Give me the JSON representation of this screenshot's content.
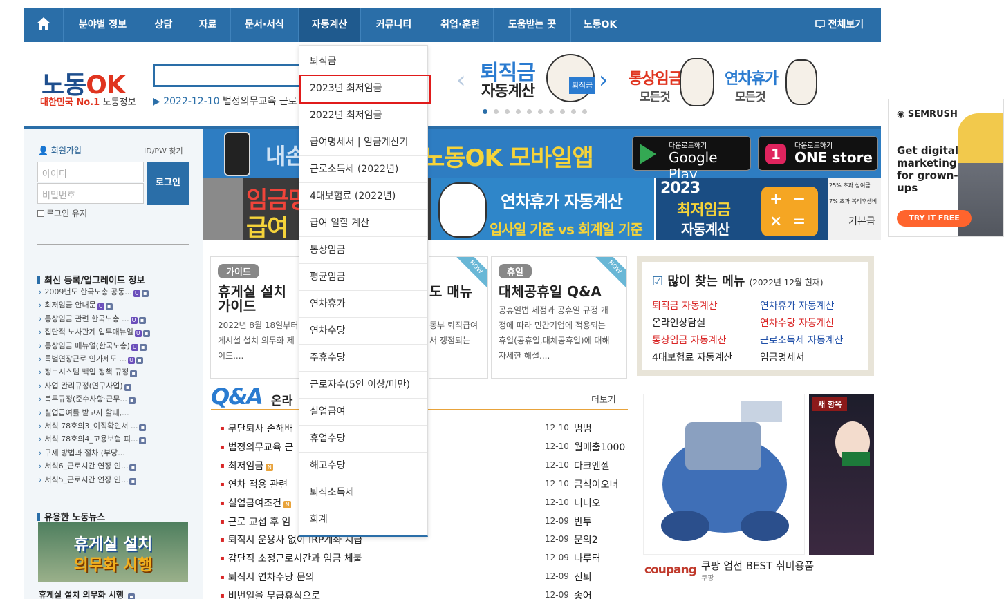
{
  "nav": {
    "items": [
      "분야별 정보",
      "상담",
      "자료",
      "문서·서식",
      "자동계산",
      "커뮤니티",
      "취업·훈련",
      "도움받는 곳",
      "노동OK"
    ],
    "active": "자동계산",
    "view_all": "전체보기"
  },
  "header": {
    "logo_main": "노동",
    "logo_ok": "OK",
    "logo_sub_red": "대한민국 No.1",
    "logo_sub": "노동정보",
    "ticker_date": "2022-12-10",
    "ticker_text": "법정의무교육 근로",
    "banner_retire_title": "퇴직금",
    "banner_retire_sub": "자동계산",
    "banner_retire_badge": "퇴직금",
    "banner_ordinary_title": "통상임금",
    "banner_ordinary_sub": "모든것",
    "banner_annual_title": "연차휴가",
    "banner_annual_sub": "모든것"
  },
  "login": {
    "join": "회원가입",
    "find": "ID/PW 찾기",
    "id_placeholder": "아이디",
    "pw_placeholder": "비밀번호",
    "button": "로그인",
    "keep": "로그인 유지"
  },
  "latest": {
    "title": "최신 등록/업그레이드 정보",
    "items": [
      "2009년도 한국노총 공동...",
      "최저임금 안내문",
      "통상임금 관련 한국노총 ...",
      "집단적 노사관계 업무매뉴얼",
      "통상임금 매뉴얼(한국노총)",
      "특별연장근로 인가제도 ...",
      "정보시스템 백업 정책 규정",
      "사업 관리규정(연구사업)",
      "복무규정(준수사항·근무...",
      "실업급여를 받고자 할때,...",
      "서식 78호의3_이직확인서 ...",
      "서식 78호의4_고용보험 피...",
      "구제 방법과 절차 (부당...",
      "서식6_근로시간 연장 인...",
      "서식5_근로시간 연장 인..."
    ]
  },
  "news": {
    "title": "유용한 노동뉴스",
    "image_text1": "휴게실 설치",
    "image_text2": "의무화 시행",
    "caption": "휴게실 설치 의무화 시행"
  },
  "app_banner": {
    "text_left": "내손",
    "text_main": "노동OK 모바일앱",
    "google_small": "다운로드하기",
    "google_big": "Google Play",
    "one_small": "다운로드하기",
    "one_big": "ONE store"
  },
  "banners": {
    "wage1": "임금명",
    "wage2": "급여",
    "annual_title": "연차휴가 자동계산",
    "annual_sub": "입사일 기준 vs 회계일 기준",
    "min_year": "2023",
    "min_title": "최저임금",
    "min_sub": "자동계산",
    "tag1": "25% 초과 상여금",
    "tag2": "7% 초과 복리후생비",
    "tag3": "기본급"
  },
  "cards": [
    {
      "tag": "가이드",
      "title1": "휴게실 설치",
      "title2": "가이드",
      "text": [
        "2022년 8월 18일부터 사",
        "게시설 설치 의무화 제",
        "이드...."
      ]
    },
    {
      "tag": "",
      "title1": "도 매뉴",
      "title2": "",
      "text": [
        "동부 퇴직급여",
        "서 쟁점되는",
        ""
      ]
    },
    {
      "tag": "휴일",
      "title1": "대체공휴일 Q&A",
      "title2": "",
      "text": [
        "공휴일법 제정과 공휴일 규정 개",
        "정에 따라 민간기업에 적용되는",
        "휴일(공휴일,대체공휴일)에 대해",
        "자세한 해설...."
      ]
    }
  ],
  "now_label": "NOW",
  "popular": {
    "title": "많이 찾는 메뉴",
    "date": "(2022년 12월 현재)",
    "links": [
      {
        "text": "퇴직금 자동계산",
        "color": "red"
      },
      {
        "text": "연차휴가 자동계산",
        "color": "blue"
      },
      {
        "text": "온라인상담실",
        "color": "dark"
      },
      {
        "text": "연차수당 자동계산",
        "color": "red"
      },
      {
        "text": "통상임금 자동계산",
        "color": "red"
      },
      {
        "text": "근로소득세 자동계산",
        "color": "blue"
      },
      {
        "text": "4대보험료 자동계산",
        "color": "dark"
      },
      {
        "text": "임금명세서",
        "color": "dark"
      }
    ]
  },
  "qa": {
    "logo": "Q&A",
    "title": "온라",
    "more": "더보기",
    "rows": [
      {
        "title": "무단퇴사 손해배",
        "date": "12-10",
        "author": "범범",
        "new": false
      },
      {
        "title": "법정의무교육 근",
        "date": "12-10",
        "author": "월매출1000",
        "new": false
      },
      {
        "title": "최저임금",
        "date": "12-10",
        "author": "다크엔젤",
        "new": true
      },
      {
        "title": "연차 적용 관련",
        "date": "12-10",
        "author": "큼식이오너",
        "new": false
      },
      {
        "title": "실업급여조건",
        "date": "12-10",
        "author": "니니오",
        "new": true
      },
      {
        "title": "근로 교섭 후 임",
        "date": "12-09",
        "author": "반투",
        "new": false
      },
      {
        "title": "퇴직시 운용사 없이 IRP계좌 지급",
        "date": "12-09",
        "author": "문의2",
        "new": false
      },
      {
        "title": "감단직 소정근로시간과 임금 체불",
        "date": "12-09",
        "author": "나루터",
        "new": false
      },
      {
        "title": "퇴직시 연차수당 문의",
        "date": "12-09",
        "author": "진퇴",
        "new": false
      },
      {
        "title": "비번일을 무급휴식으로",
        "date": "12-09",
        "author": "송어",
        "new": false
      }
    ]
  },
  "ad": {
    "new_badge": "새 항목",
    "coupang": "coupang",
    "title": "쿠팡 엄선 BEST 취미용품",
    "sub": "쿠팡"
  },
  "semrush": {
    "logo": "SEMRUSH",
    "text": "Get digital marketing for grown-ups",
    "button": "TRY IT FREE"
  },
  "dropdown": {
    "items": [
      "퇴직금",
      "2023년 최저임금",
      "2022년 최저임금",
      "급여명세서 | 임금계산기",
      "근로소득세 (2022년)",
      "4대보험료 (2022년)",
      "급여 일할 계산",
      "통상임금",
      "평균임금",
      "연차휴가",
      "연차수당",
      "주휴수당",
      "근로자수(5인 이상/미만)",
      "실업급여",
      "휴업수당",
      "해고수당",
      "퇴직소득세",
      "회계"
    ]
  },
  "colors": {
    "brand": "#2a6ea8",
    "accent_red": "#e01b1b",
    "orange": "#e8a33b"
  }
}
